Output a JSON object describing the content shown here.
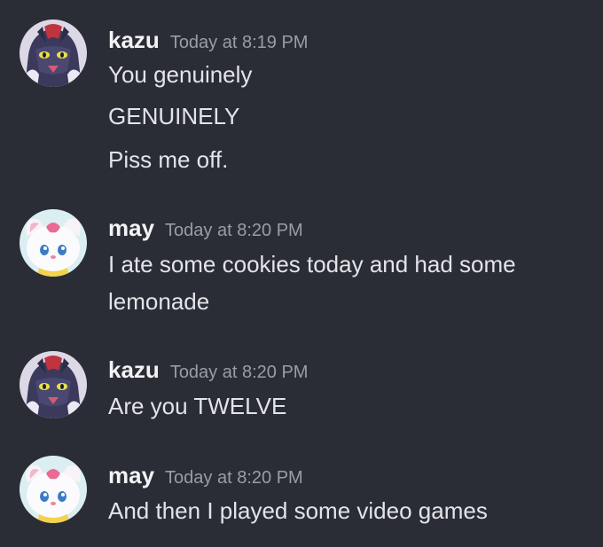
{
  "messages": [
    {
      "author": "kazu",
      "timestamp": "Today at 8:19 PM",
      "avatar_icon": "kazu-avatar-icon",
      "lines": [
        "You genuinely",
        "GENUINELY",
        "Piss me off."
      ]
    },
    {
      "author": "may",
      "timestamp": "Today at 8:20 PM",
      "avatar_icon": "may-avatar-icon",
      "lines": [
        "I ate some cookies today and had some",
        "lemonade"
      ]
    },
    {
      "author": "kazu",
      "timestamp": "Today at 8:20 PM",
      "avatar_icon": "kazu-avatar-icon",
      "lines": [
        "Are you TWELVE"
      ]
    },
    {
      "author": "may",
      "timestamp": "Today at 8:20 PM",
      "avatar_icon": "may-avatar-icon",
      "lines": [
        "And then I played some video games"
      ]
    }
  ],
  "colors": {
    "background": "#2b2d36",
    "username": "#f2f3f5",
    "timestamp": "#9a9ca6",
    "message_text": "#e3e4e8"
  }
}
